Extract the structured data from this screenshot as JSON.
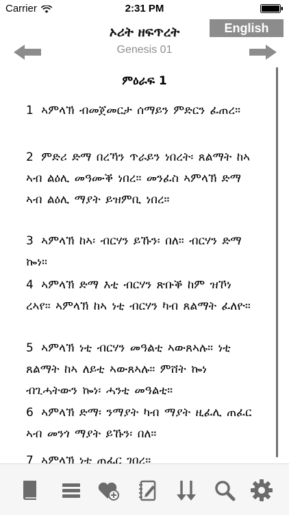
{
  "status_bar": {
    "carrier": "Carrier",
    "time": "2:31 PM"
  },
  "header": {
    "book_title": "ኦሪት ዘፍጥረት",
    "chapter_ref": "Genesis 01",
    "language_button": "English"
  },
  "content": {
    "chapter_heading": "ምዕራፍ 1",
    "verses": [
      {
        "num": "1",
        "text": "ኣምላኽ ብመጀመርታ ሰማይን ምድርን ፈጠረ።"
      },
      {
        "num": "2",
        "text": "ምድሪ ድማ በረኻን ጥራይን ነበረት፡ ጸልማት ከኣ ኣብ ልዕሊ መዓሙቕ ነበረ። መንፈስ ኣምላኽ ድማ ኣብ ልዕሊ ማያት ይዝምቢ ነበረ።"
      },
      {
        "num": "3",
        "text": "ኣምላኽ ከኣ፡ ብርሃን ይኹን፡ በለ። ብርሃን ድማ ኰነ።"
      },
      {
        "num": "4",
        "text": "ኣምላኽ ድማ እቲ ብርሃን ጽቡቕ ከም ዝኾነ ረኣየ። ኣምላኽ ከኣ ነቲ ብርሃን ካብ ጸልማት ፈለዮ።"
      },
      {
        "num": "5",
        "text": "ኣምላኽ ነቲ ብርሃን መዓልቲ ኣውጸኣሉ። ነቲ ጸልማት ከኣ ለይቲ ኣውጸኣሉ። ምሸት ኰነ ብጊሓትውን ኰነ፡ ሓንቲ መዓልቲ።"
      },
      {
        "num": "6",
        "text": "ኣምላኽ ድማ፡ ንማያት ካብ ማያት ዚፈሊ ጠፈር ኣብ መንጎ ማያት ይኹን፡ በለ።"
      },
      {
        "num": "7",
        "text": "ኣምላኽ ነቲ ጠፈር ገበረ።"
      }
    ]
  },
  "toolbar": {
    "items": [
      {
        "name": "book-icon"
      },
      {
        "name": "menu-list-icon"
      },
      {
        "name": "heart-add-icon"
      },
      {
        "name": "notebook-edit-icon"
      },
      {
        "name": "sort-arrows-icon"
      },
      {
        "name": "search-icon"
      },
      {
        "name": "gear-icon"
      }
    ]
  },
  "colors": {
    "button_gray": "#8c8c8c",
    "icon_gray": "#6b6b6b",
    "subtitle_gray": "#8e8e8e",
    "toolbar_bg": "#f6f6f6"
  }
}
